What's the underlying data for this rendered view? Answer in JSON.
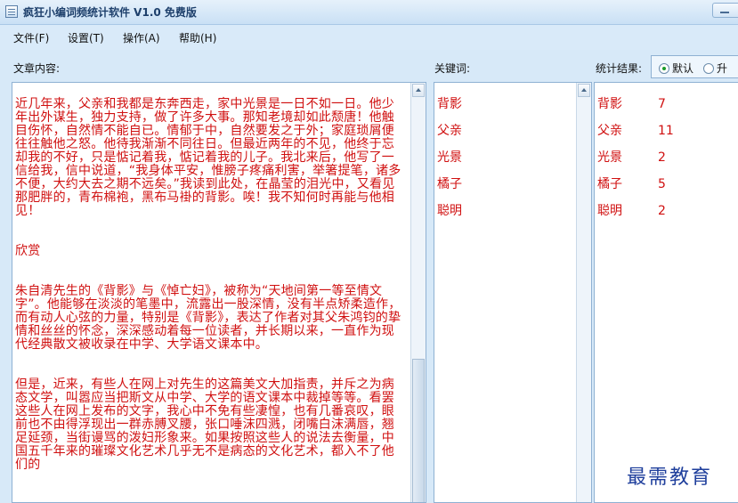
{
  "window": {
    "title": "疯狂小编词频统计软件 V1.0 免费版"
  },
  "menu": {
    "items": [
      {
        "label": "文件(F)"
      },
      {
        "label": "设置(T)"
      },
      {
        "label": "操作(A)"
      },
      {
        "label": "帮助(H)"
      }
    ]
  },
  "labels": {
    "article": "文章内容:",
    "keywords": "关键词:",
    "results": "统计结果:"
  },
  "sort": {
    "options": [
      {
        "label": "默认",
        "checked": true
      },
      {
        "label": "升",
        "checked": false
      }
    ]
  },
  "article": {
    "paragraphs": [
      "近几年来，父亲和我都是东奔西走，家中光景是一日不如一日。他少年出外谋生，独力支持，做了许多大事。那知老境却如此颓唐！他触目伤怀，自然情不能自已。情郁于中，自然要发之于外；家庭琐屑便往往触他之怒。他待我渐渐不同往日。但最近两年的不见，他终于忘却我的不好，只是惦记着我，惦记着我的儿子。我北来后，他写了一信给我，信中说道，“我身体平安，惟膀子疼痛利害，举箸提笔，诸多不便，大约大去之期不远矣。”我读到此处，在晶莹的泪光中，又看见那肥胖的，青布棉袍，黑布马褂的背影。唉！我不知何时再能与他相见！",
      "欣赏",
      "朱自清先生的《背影》与《悼亡妇》，被称为“天地间第一等至情文字”。他能够在淡淡的笔墨中，流露出一股深情，没有半点矫柔造作，而有动人心弦的力量，特别是《背影》，表达了作者对其父朱鸿钧的挚情和丝丝的怀念，深深感动着每一位读者，并长期以来，一直作为现代经典散文被收录在中学、大学语文课本中。",
      "但是，近来，有些人在网上对先生的这篇美文大加指责，并斥之为病态文学，叫嚣应当把斯文从中学、大学的语文课本中裁掉等等。看罢这些人在网上发布的文字，我心中不免有些凄惶，也有几番哀叹，眼前也不由得浮现出一群赤膊叉腰，张口唾沫四溅，闭嘴白沫满唇，翘足延颈，当街谩骂的泼妇形象来。如果按照这些人的说法去衡量，中国五千年来的璀璨文化艺术几乎无不是病态的文化艺术，都入不了他们的"
    ]
  },
  "keywords": {
    "items": [
      "背影",
      "父亲",
      "光景",
      "橘子",
      "聪明"
    ]
  },
  "results": {
    "rows": [
      {
        "word": "背影",
        "count": "7"
      },
      {
        "word": "父亲",
        "count": "11"
      },
      {
        "word": "光景",
        "count": "2"
      },
      {
        "word": "橘子",
        "count": "5"
      },
      {
        "word": "聪明",
        "count": "2"
      }
    ]
  },
  "watermark": "最需教育"
}
